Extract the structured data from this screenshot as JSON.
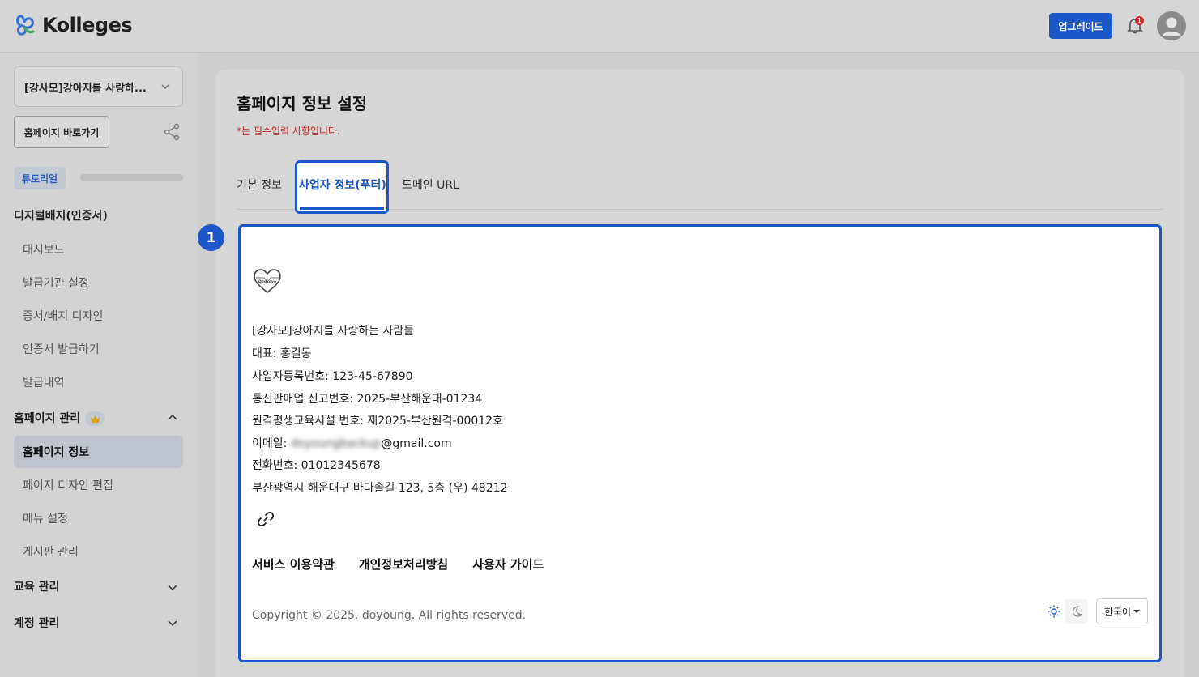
{
  "header": {
    "brand": "Kolleges",
    "upgrade_label": "업그레이드",
    "notification_count": "1"
  },
  "sidebar": {
    "org_name": "[강사모]강아지를 사랑하...",
    "homepage_link_label": "홈페이지 바로가기",
    "tutorial_label": "튜토리얼",
    "tutorial_progress": 0,
    "sections": [
      {
        "label": "디지털배지(인증서)",
        "items": [
          "대시보드",
          "발급기관 설정",
          "증서/배지 디자인",
          "인증서 발급하기",
          "발급내역"
        ]
      },
      {
        "label": "홈페이지 관리",
        "items": [
          "홈페이지 정보",
          "페이지 디자인 편집",
          "메뉴 설정",
          "게시판 관리"
        ],
        "active_item": "홈페이지 정보"
      },
      {
        "label": "교육 관리",
        "items": []
      },
      {
        "label": "계정 관리",
        "items": []
      }
    ]
  },
  "main": {
    "title": "홈페이지 정보 설정",
    "required_note": "*는 필수입력 사항입니다.",
    "tabs": [
      {
        "label": "기본 정보",
        "active": false
      },
      {
        "label": "사업자 정보(푸터)",
        "active": true
      },
      {
        "label": "도메인 URL",
        "active": false
      }
    ],
    "step_badge": "1",
    "footer_preview": {
      "logo_text": "DogLove",
      "company": "[강사모]강아지를 사랑하는 사람들",
      "representative": "대표: 홍길동",
      "business_number": "사업자등록번호: 123-45-67890",
      "ecommerce_number": "통신판매업 신고번호: 2025-부산해운대-01234",
      "education_number": "원격평생교육시설 번호: 제2025-부산원격-00012호",
      "email_label": "이메일: ",
      "email_hidden": "doyoungbackup",
      "email_domain": "@gmail.com",
      "phone": "전화번호: 01012345678",
      "address": "부산광역시 해운대구 바다솔길 123, 5층 (우) 48212",
      "links": [
        "서비스 이용약관",
        "개인정보처리방침",
        "사용자 가이드"
      ],
      "copyright": "Copyright © 2025. doyoung. All rights reserved.",
      "language": "한국어"
    }
  },
  "colors": {
    "accent": "#1c57c7",
    "required": "#c22a2a",
    "overlay_bg": "#d6d6d6"
  }
}
